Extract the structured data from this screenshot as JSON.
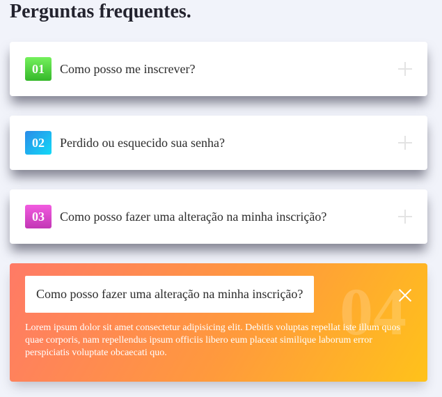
{
  "page": {
    "title": "Perguntas frequentes."
  },
  "faq": [
    {
      "number": "01",
      "question": "Como posso me inscrever?",
      "icon": "plus-icon",
      "color": "#4fd23f"
    },
    {
      "number": "02",
      "question": "Perdido ou esquecido sua senha?",
      "icon": "plus-icon",
      "color": "#1fb3f0"
    },
    {
      "number": "03",
      "question": "Como posso fazer uma alteração na minha inscrição?",
      "icon": "plus-icon",
      "color": "#d947cc"
    }
  ],
  "active": {
    "number": "04",
    "question": "Como posso fazer uma alteração na minha inscrição?",
    "answer": "Lorem ipsum dolor sit amet consectetur adipisicing elit. Debitis voluptas repellat iste illum quos quae corporis, nam repellendus ipsum officiis libero eum placeat similique laborum error perspiciatis voluptate obcaecati quo.",
    "icon": "close-icon",
    "gradient": [
      "#ff7a66",
      "#ff9a3c",
      "#ffc21a"
    ]
  }
}
